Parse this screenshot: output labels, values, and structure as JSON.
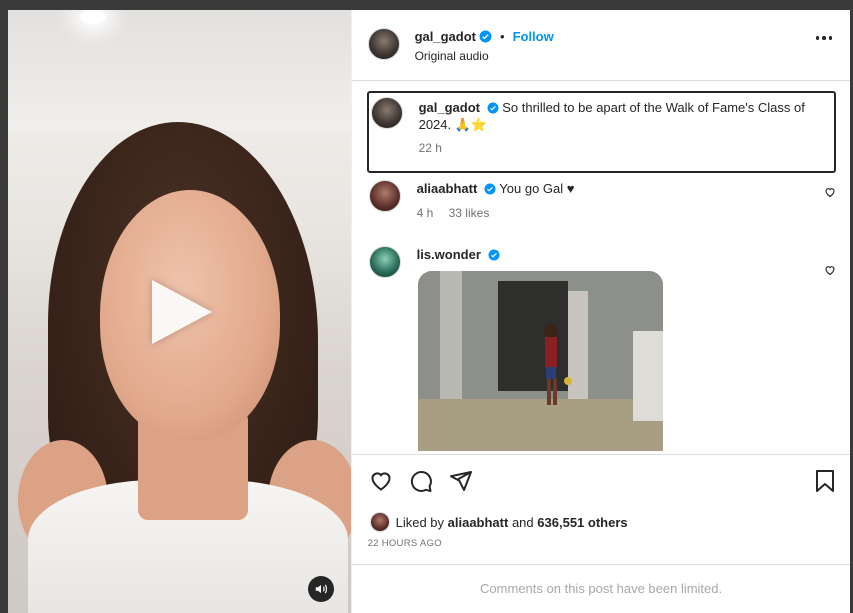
{
  "header": {
    "username": "gal_gadot",
    "separator": "•",
    "follow_label": "Follow",
    "subtitle": "Original audio",
    "avatar_icon": "avatar-icon",
    "more_icon": "more-options-icon"
  },
  "caption": {
    "username": "gal_gadot",
    "text": "So thrilled to be apart of the Walk of Fame's Class of 2024. 🙏⭐",
    "time": "22 h"
  },
  "comments": [
    {
      "username": "aliaabhatt",
      "text": "You go Gal ♥",
      "time": "4 h",
      "likes": "33 likes"
    },
    {
      "username": "lis.wonder",
      "text": "",
      "time": "",
      "likes": ""
    }
  ],
  "actions": {
    "like_icon": "heart-icon",
    "comment_icon": "comment-icon",
    "share_icon": "send-icon",
    "save_icon": "bookmark-icon"
  },
  "likes": {
    "prefix": "Liked by",
    "user": "aliaabhatt",
    "middle": "and",
    "others": "636,551 others"
  },
  "posted_ago": "22 HOURS AGO",
  "comments_limited": "Comments on this post have been limited.",
  "colors": {
    "accent": "#0095f6",
    "verified": "#0095f6",
    "text": "#262626",
    "muted": "#737373"
  }
}
